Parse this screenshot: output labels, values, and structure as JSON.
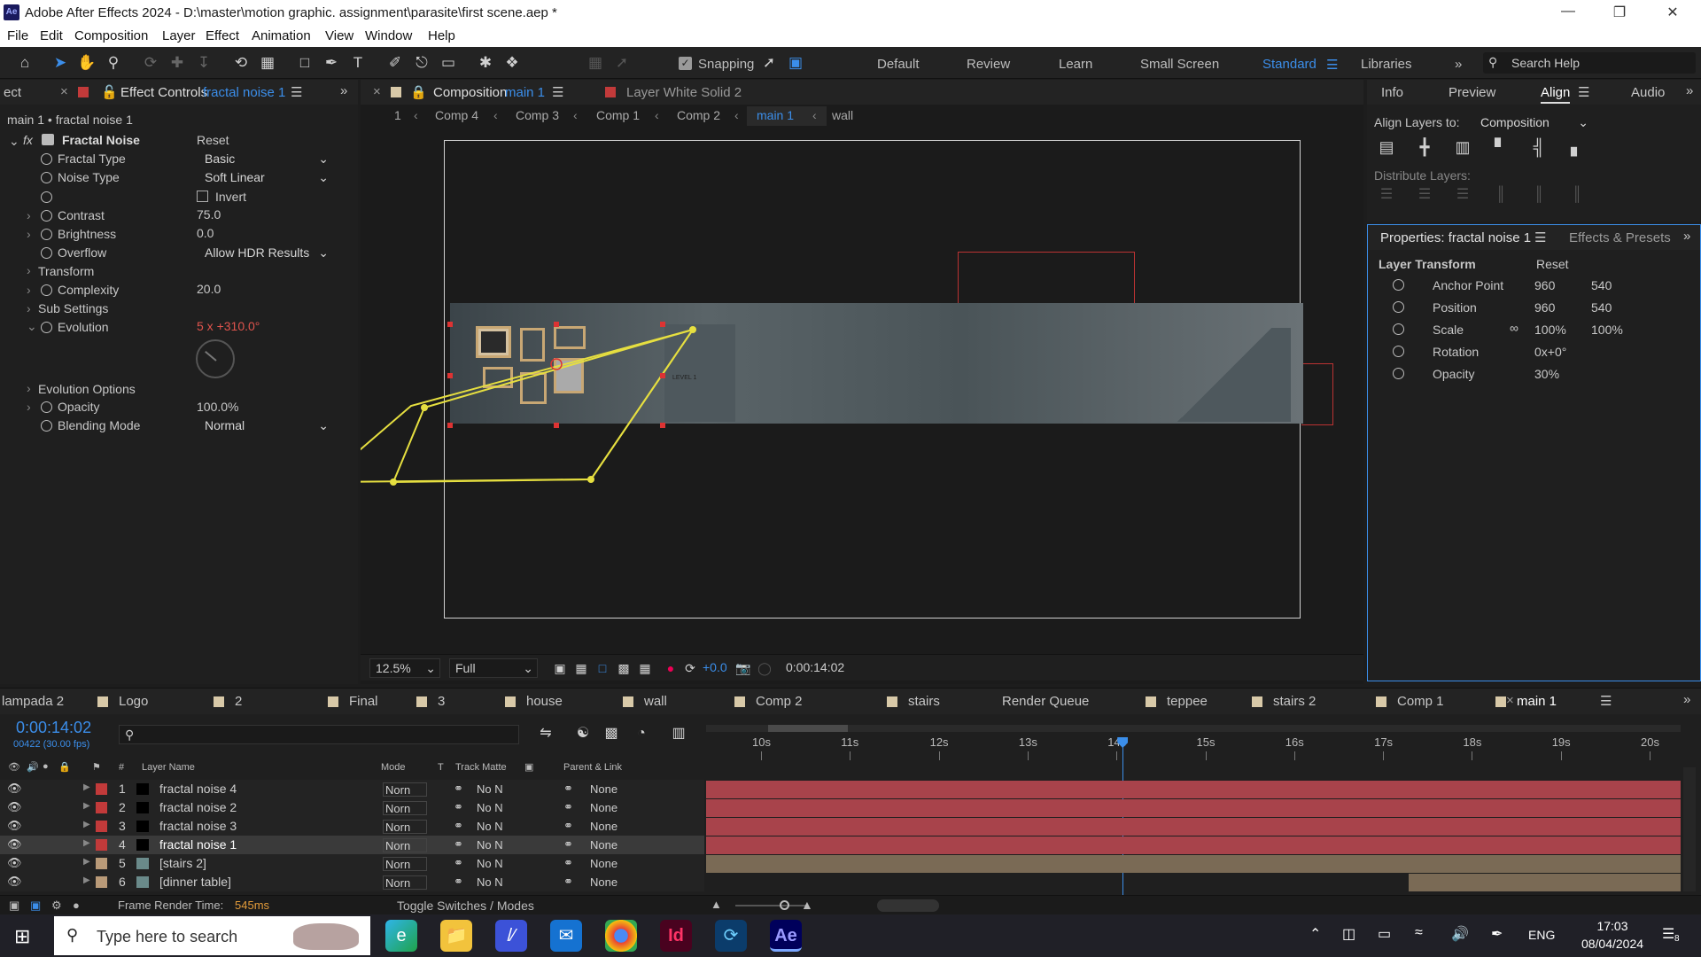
{
  "app": {
    "title": "Adobe After Effects 2024 - D:\\master\\motion graphic. assignment\\parasite\\first scene.aep *",
    "logo": "Ae"
  },
  "menu": [
    "File",
    "Edit",
    "Composition",
    "Layer",
    "Effect",
    "Animation",
    "View",
    "Window",
    "Help"
  ],
  "toolbar": {
    "snapping": "Snapping",
    "workspaces": [
      "Default",
      "Review",
      "Learn",
      "Small Screen",
      "Standard",
      "Libraries"
    ],
    "search": "Search Help"
  },
  "effect_controls": {
    "tab_prefix": "ect",
    "tab_label": "Effect Controls",
    "tab_layer": "fractal noise 1",
    "subtitle": "main 1 • fractal noise 1",
    "effect_name": "Fractal Noise",
    "reset": "Reset",
    "props": [
      {
        "name": "Fractal Type",
        "value": "Basic",
        "kind": "dropdown"
      },
      {
        "name": "Noise Type",
        "value": "Soft Linear",
        "kind": "dropdown"
      },
      {
        "name": "",
        "value": "Invert",
        "kind": "checkbox"
      },
      {
        "name": "Contrast",
        "value": "75.0",
        "kind": "number"
      },
      {
        "name": "Brightness",
        "value": "0.0",
        "kind": "number"
      },
      {
        "name": "Overflow",
        "value": "Allow HDR Results",
        "kind": "dropdown"
      },
      {
        "name": "Transform",
        "value": "",
        "kind": "group"
      },
      {
        "name": "Complexity",
        "value": "20.0",
        "kind": "number"
      },
      {
        "name": "Sub Settings",
        "value": "",
        "kind": "group"
      },
      {
        "name": "Evolution",
        "value": "5 x +310.0°",
        "kind": "red"
      }
    ],
    "evolution_options": "Evolution Options",
    "opacity_label": "Opacity",
    "opacity": "100.0%",
    "blending_label": "Blending Mode",
    "blending": "Normal"
  },
  "composition": {
    "tab_label": "Composition",
    "tab_comp": "main 1",
    "layer_tab": "Layer  White Solid 2",
    "breadcrumb": [
      "1",
      "Comp 4",
      "Comp 3",
      "Comp 1",
      "Comp 2",
      "main 1",
      "wall"
    ],
    "zoom": "12.5%",
    "resolution": "Full",
    "exposure": "+0.0",
    "timecode": "0:00:14:02",
    "text_lines": [
      "LEVEL 1",
      "",
      "",
      "",
      ""
    ]
  },
  "right_top": {
    "tabs": [
      "Info",
      "Preview",
      "Align",
      "Audio"
    ],
    "align_to_label": "Align Layers to:",
    "align_to": "Composition",
    "distribute": "Distribute Layers:"
  },
  "properties": {
    "tab": "Properties: fractal noise 1",
    "tab2": "Effects & Presets",
    "section": "Layer Transform",
    "reset": "Reset",
    "rows": [
      {
        "name": "Anchor Point",
        "v1": "960",
        "v2": "540"
      },
      {
        "name": "Position",
        "v1": "960",
        "v2": "540"
      },
      {
        "name": "Scale",
        "v1": "100%",
        "v2": "100%"
      },
      {
        "name": "Rotation",
        "v1": "0x+0°",
        "v2": ""
      },
      {
        "name": "Opacity",
        "v1": "30%",
        "v2": ""
      }
    ]
  },
  "timeline": {
    "tabs": [
      "lampada 2",
      "Logo",
      "2",
      "Final",
      "3",
      "house",
      "wall",
      "Comp 2",
      "stairs",
      "Render Queue",
      "teppee",
      "stairs 2",
      "Comp 1",
      "main 1"
    ],
    "timecode": "0:00:14:02",
    "frames": "00422 (30.00 fps)",
    "headers": {
      "num": "#",
      "name": "Layer Name",
      "mode": "Mode",
      "t": "T",
      "matte": "Track Matte",
      "parent": "Parent & Link"
    },
    "ruler": [
      "10s",
      "11s",
      "12s",
      "13s",
      "14s",
      "15s",
      "16s",
      "17s",
      "18s",
      "19s",
      "20s"
    ],
    "playhead_s": 14.07,
    "layers": [
      {
        "num": "1",
        "name": "fractal noise 4",
        "mode": "Norn",
        "matte": "No N",
        "parent": "None",
        "color": "#c23a3a"
      },
      {
        "num": "2",
        "name": "fractal noise 2",
        "mode": "Norn",
        "matte": "No N",
        "parent": "None",
        "color": "#c23a3a"
      },
      {
        "num": "3",
        "name": "fractal noise 3",
        "mode": "Norn",
        "matte": "No N",
        "parent": "None",
        "color": "#c23a3a"
      },
      {
        "num": "4",
        "name": "fractal noise 1",
        "mode": "Norn",
        "matte": "No N",
        "parent": "None",
        "color": "#c23a3a"
      },
      {
        "num": "5",
        "name": "[stairs 2]",
        "mode": "Norn",
        "matte": "No N",
        "parent": "None",
        "color": "#b99a78"
      },
      {
        "num": "6",
        "name": "[dinner table]",
        "mode": "Norn",
        "matte": "No N",
        "parent": "None",
        "color": "#b99a78"
      }
    ],
    "render_label": "Frame Render Time:",
    "render_time": "545ms",
    "toggle": "Toggle Switches / Modes"
  },
  "taskbar": {
    "search": "Type here to search",
    "lang": "ENG",
    "time": "17:03",
    "date": "08/04/2024",
    "notif": "8"
  }
}
